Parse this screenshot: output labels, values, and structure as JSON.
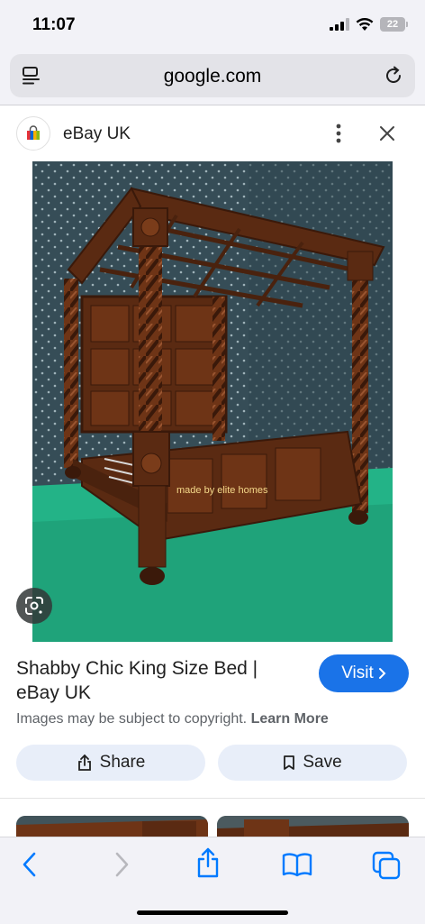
{
  "status_bar": {
    "time": "11:07",
    "battery": "22"
  },
  "browser": {
    "url": "google.com"
  },
  "source": {
    "name": "eBay UK"
  },
  "image": {
    "watermark": "made by elite homes"
  },
  "result": {
    "title": "Shabby Chic King Size Bed | eBay UK",
    "visit_label": "Visit",
    "copyright_text": "Images may be subject to copyright.",
    "learn_more": "Learn More"
  },
  "actions": {
    "share_label": "Share",
    "save_label": "Save"
  },
  "colors": {
    "accent": "#1a73e8",
    "action_bg": "#e8eef9",
    "chrome_bg": "#f2f2f7",
    "ios_blue": "#007aff"
  },
  "toolbar_icons": [
    "back-icon",
    "forward-icon",
    "share-icon",
    "bookmarks-icon",
    "tabs-icon"
  ]
}
